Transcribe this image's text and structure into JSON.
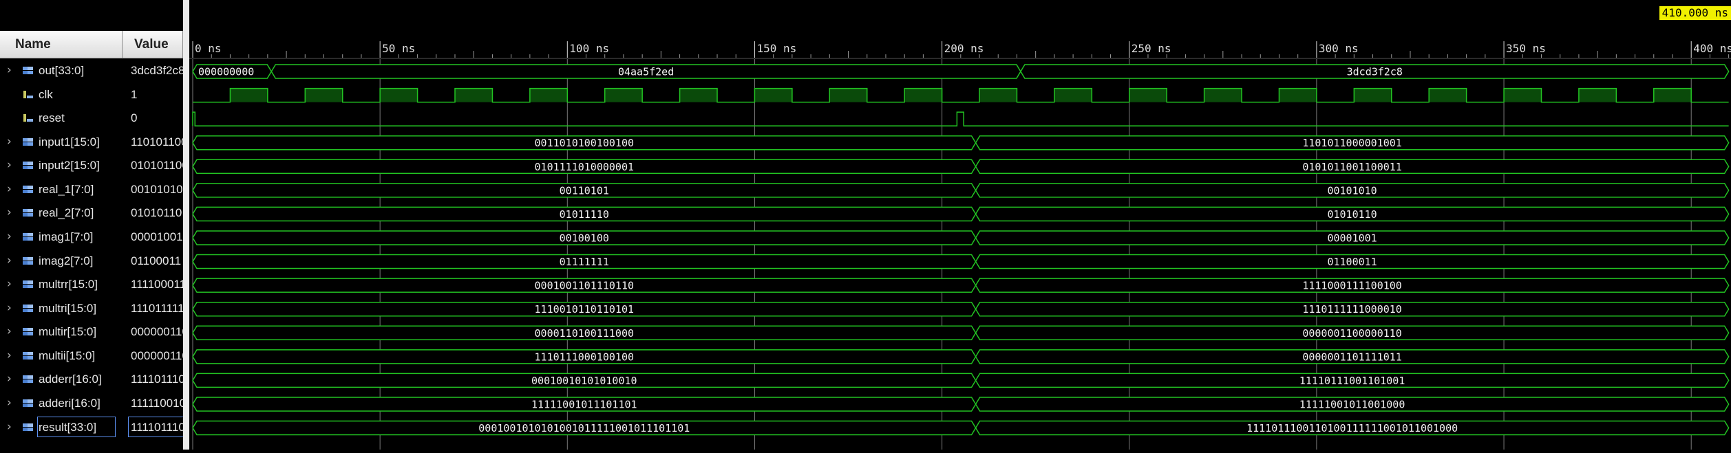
{
  "headers": {
    "name": "Name",
    "value": "Value"
  },
  "cursor_time": "410.000 ns",
  "time_axis": {
    "unit": "ns",
    "range": [
      0,
      410
    ],
    "major_ticks": [
      0,
      50,
      100,
      150,
      200,
      250,
      300,
      350,
      400
    ]
  },
  "colors": {
    "waveform": "#22c322",
    "bus_fill": "#000000",
    "clk_fill": "#0a4a0a",
    "gridline": "#7a7a7a",
    "cursor_badge": "#f0f000"
  },
  "signals": [
    {
      "name": "out[33:0]",
      "value": "3dcd3f2c8",
      "kind": "bus",
      "expandable": true,
      "segments": [
        {
          "start": 0,
          "end": 21,
          "label": "000000000"
        },
        {
          "start": 21,
          "end": 221,
          "label": "04aa5f2ed"
        },
        {
          "start": 221,
          "end": 410,
          "label": "3dcd3f2c8"
        }
      ]
    },
    {
      "name": "clk",
      "value": "1",
      "kind": "clock",
      "expandable": false,
      "period_ns": 20,
      "first_rise_ns": 10
    },
    {
      "name": "reset",
      "value": "0",
      "kind": "bit",
      "expandable": false,
      "pulses": [
        [
          0,
          0.6
        ],
        [
          204,
          205.8
        ]
      ]
    },
    {
      "name": "input1[15:0]",
      "value": "1101011000001001",
      "kind": "bus",
      "expandable": true,
      "segments": [
        {
          "start": 0,
          "end": 209,
          "label": "0011010100100100"
        },
        {
          "start": 209,
          "end": 410,
          "label": "1101011000001001"
        }
      ]
    },
    {
      "name": "input2[15:0]",
      "value": "0101011001100011",
      "kind": "bus",
      "expandable": true,
      "segments": [
        {
          "start": 0,
          "end": 209,
          "label": "0101111010000001"
        },
        {
          "start": 209,
          "end": 410,
          "label": "0101011001100011"
        }
      ]
    },
    {
      "name": "real_1[7:0]",
      "value": "00101010",
      "kind": "bus",
      "expandable": true,
      "segments": [
        {
          "start": 0,
          "end": 209,
          "label": "00110101"
        },
        {
          "start": 209,
          "end": 410,
          "label": "00101010"
        }
      ]
    },
    {
      "name": "real_2[7:0]",
      "value": "01010110",
      "kind": "bus",
      "expandable": true,
      "segments": [
        {
          "start": 0,
          "end": 209,
          "label": "01011110"
        },
        {
          "start": 209,
          "end": 410,
          "label": "01010110"
        }
      ]
    },
    {
      "name": "imag1[7:0]",
      "value": "00001001",
      "kind": "bus",
      "expandable": true,
      "segments": [
        {
          "start": 0,
          "end": 209,
          "label": "00100100"
        },
        {
          "start": 209,
          "end": 410,
          "label": "00001001"
        }
      ]
    },
    {
      "name": "imag2[7:0]",
      "value": "01100011",
      "kind": "bus",
      "expandable": true,
      "segments": [
        {
          "start": 0,
          "end": 209,
          "label": "01111111"
        },
        {
          "start": 209,
          "end": 410,
          "label": "01100011"
        }
      ]
    },
    {
      "name": "multrr[15:0]",
      "value": "1111000111100100",
      "kind": "bus",
      "expandable": true,
      "segments": [
        {
          "start": 0,
          "end": 209,
          "label": "0001001101110110"
        },
        {
          "start": 209,
          "end": 410,
          "label": "1111000111100100"
        }
      ]
    },
    {
      "name": "multri[15:0]",
      "value": "1110111111000010",
      "kind": "bus",
      "expandable": true,
      "segments": [
        {
          "start": 0,
          "end": 209,
          "label": "1110010110110101"
        },
        {
          "start": 209,
          "end": 410,
          "label": "1110111111000010"
        }
      ]
    },
    {
      "name": "multir[15:0]",
      "value": "0000001100000110",
      "kind": "bus",
      "expandable": true,
      "segments": [
        {
          "start": 0,
          "end": 209,
          "label": "0000110100111000"
        },
        {
          "start": 209,
          "end": 410,
          "label": "0000001100000110"
        }
      ]
    },
    {
      "name": "multii[15:0]",
      "value": "0000001101111011",
      "kind": "bus",
      "expandable": true,
      "segments": [
        {
          "start": 0,
          "end": 209,
          "label": "1110111000100100"
        },
        {
          "start": 209,
          "end": 410,
          "label": "0000001101111011"
        }
      ]
    },
    {
      "name": "adderr[16:0]",
      "value": "11110111001101001",
      "kind": "bus",
      "expandable": true,
      "segments": [
        {
          "start": 0,
          "end": 209,
          "label": "00010010101010010"
        },
        {
          "start": 209,
          "end": 410,
          "label": "11110111001101001"
        }
      ]
    },
    {
      "name": "adderi[16:0]",
      "value": "11111001011001000",
      "kind": "bus",
      "expandable": true,
      "segments": [
        {
          "start": 0,
          "end": 209,
          "label": "11111001011101101"
        },
        {
          "start": 209,
          "end": 410,
          "label": "11111001011001000"
        }
      ]
    },
    {
      "name": "result[33:0]",
      "value": "1111011100110100111111001011001000",
      "kind": "bus",
      "expandable": true,
      "selected": true,
      "segments": [
        {
          "start": 0,
          "end": 209,
          "label": "0001001010101001011111001011101101"
        },
        {
          "start": 209,
          "end": 410,
          "label": "1111011100110100111111001011001000"
        }
      ]
    }
  ]
}
